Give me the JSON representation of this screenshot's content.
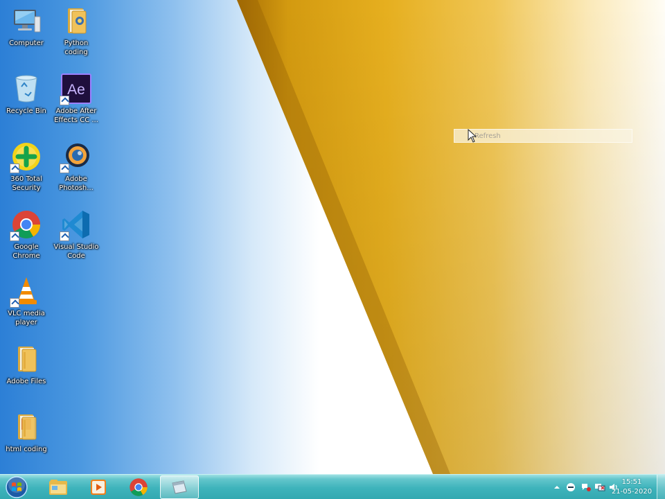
{
  "desktop": {
    "icons": [
      {
        "label": "Computer",
        "icon": "computer-icon"
      },
      {
        "label": "Python coding",
        "icon": "folder-icon"
      },
      {
        "label": "Recycle Bin",
        "icon": "recycle-bin-icon"
      },
      {
        "label": "Adobe After Effects CC ...",
        "icon": "after-effects-icon"
      },
      {
        "label": "360 Total Security",
        "icon": "360-security-icon"
      },
      {
        "label": "Adobe Photosh...",
        "icon": "photoshop-icon"
      },
      {
        "label": "Google Chrome",
        "icon": "chrome-icon"
      },
      {
        "label": "Visual Studio Code",
        "icon": "vscode-icon"
      },
      {
        "label": "VLC media player",
        "icon": "vlc-icon"
      },
      {
        "label": "Adobe Files",
        "icon": "folder-icon"
      },
      {
        "label": "html coding",
        "icon": "folder-icon"
      }
    ],
    "after_effects_glyph": "Ae"
  },
  "context_menu": {
    "items": [
      {
        "label": "Refresh"
      }
    ]
  },
  "taskbar": {
    "start": {
      "icon": "windows-start-icon"
    },
    "pinned": [
      {
        "icon": "file-explorer-icon"
      },
      {
        "icon": "media-player-icon"
      },
      {
        "icon": "chrome-icon"
      },
      {
        "icon": "window-app-icon",
        "active": true
      }
    ],
    "tray": {
      "icons": [
        "show-hidden-icons-icon",
        "360-tray-icon",
        "action-center-icon",
        "network-icon",
        "volume-icon"
      ],
      "time": "15:51",
      "date": "21-05-2020"
    }
  },
  "colors": {
    "wallpaper_gold": "#e0a820",
    "wallpaper_blue": "#2c7fd6",
    "taskbar": "#3eb3bb"
  }
}
